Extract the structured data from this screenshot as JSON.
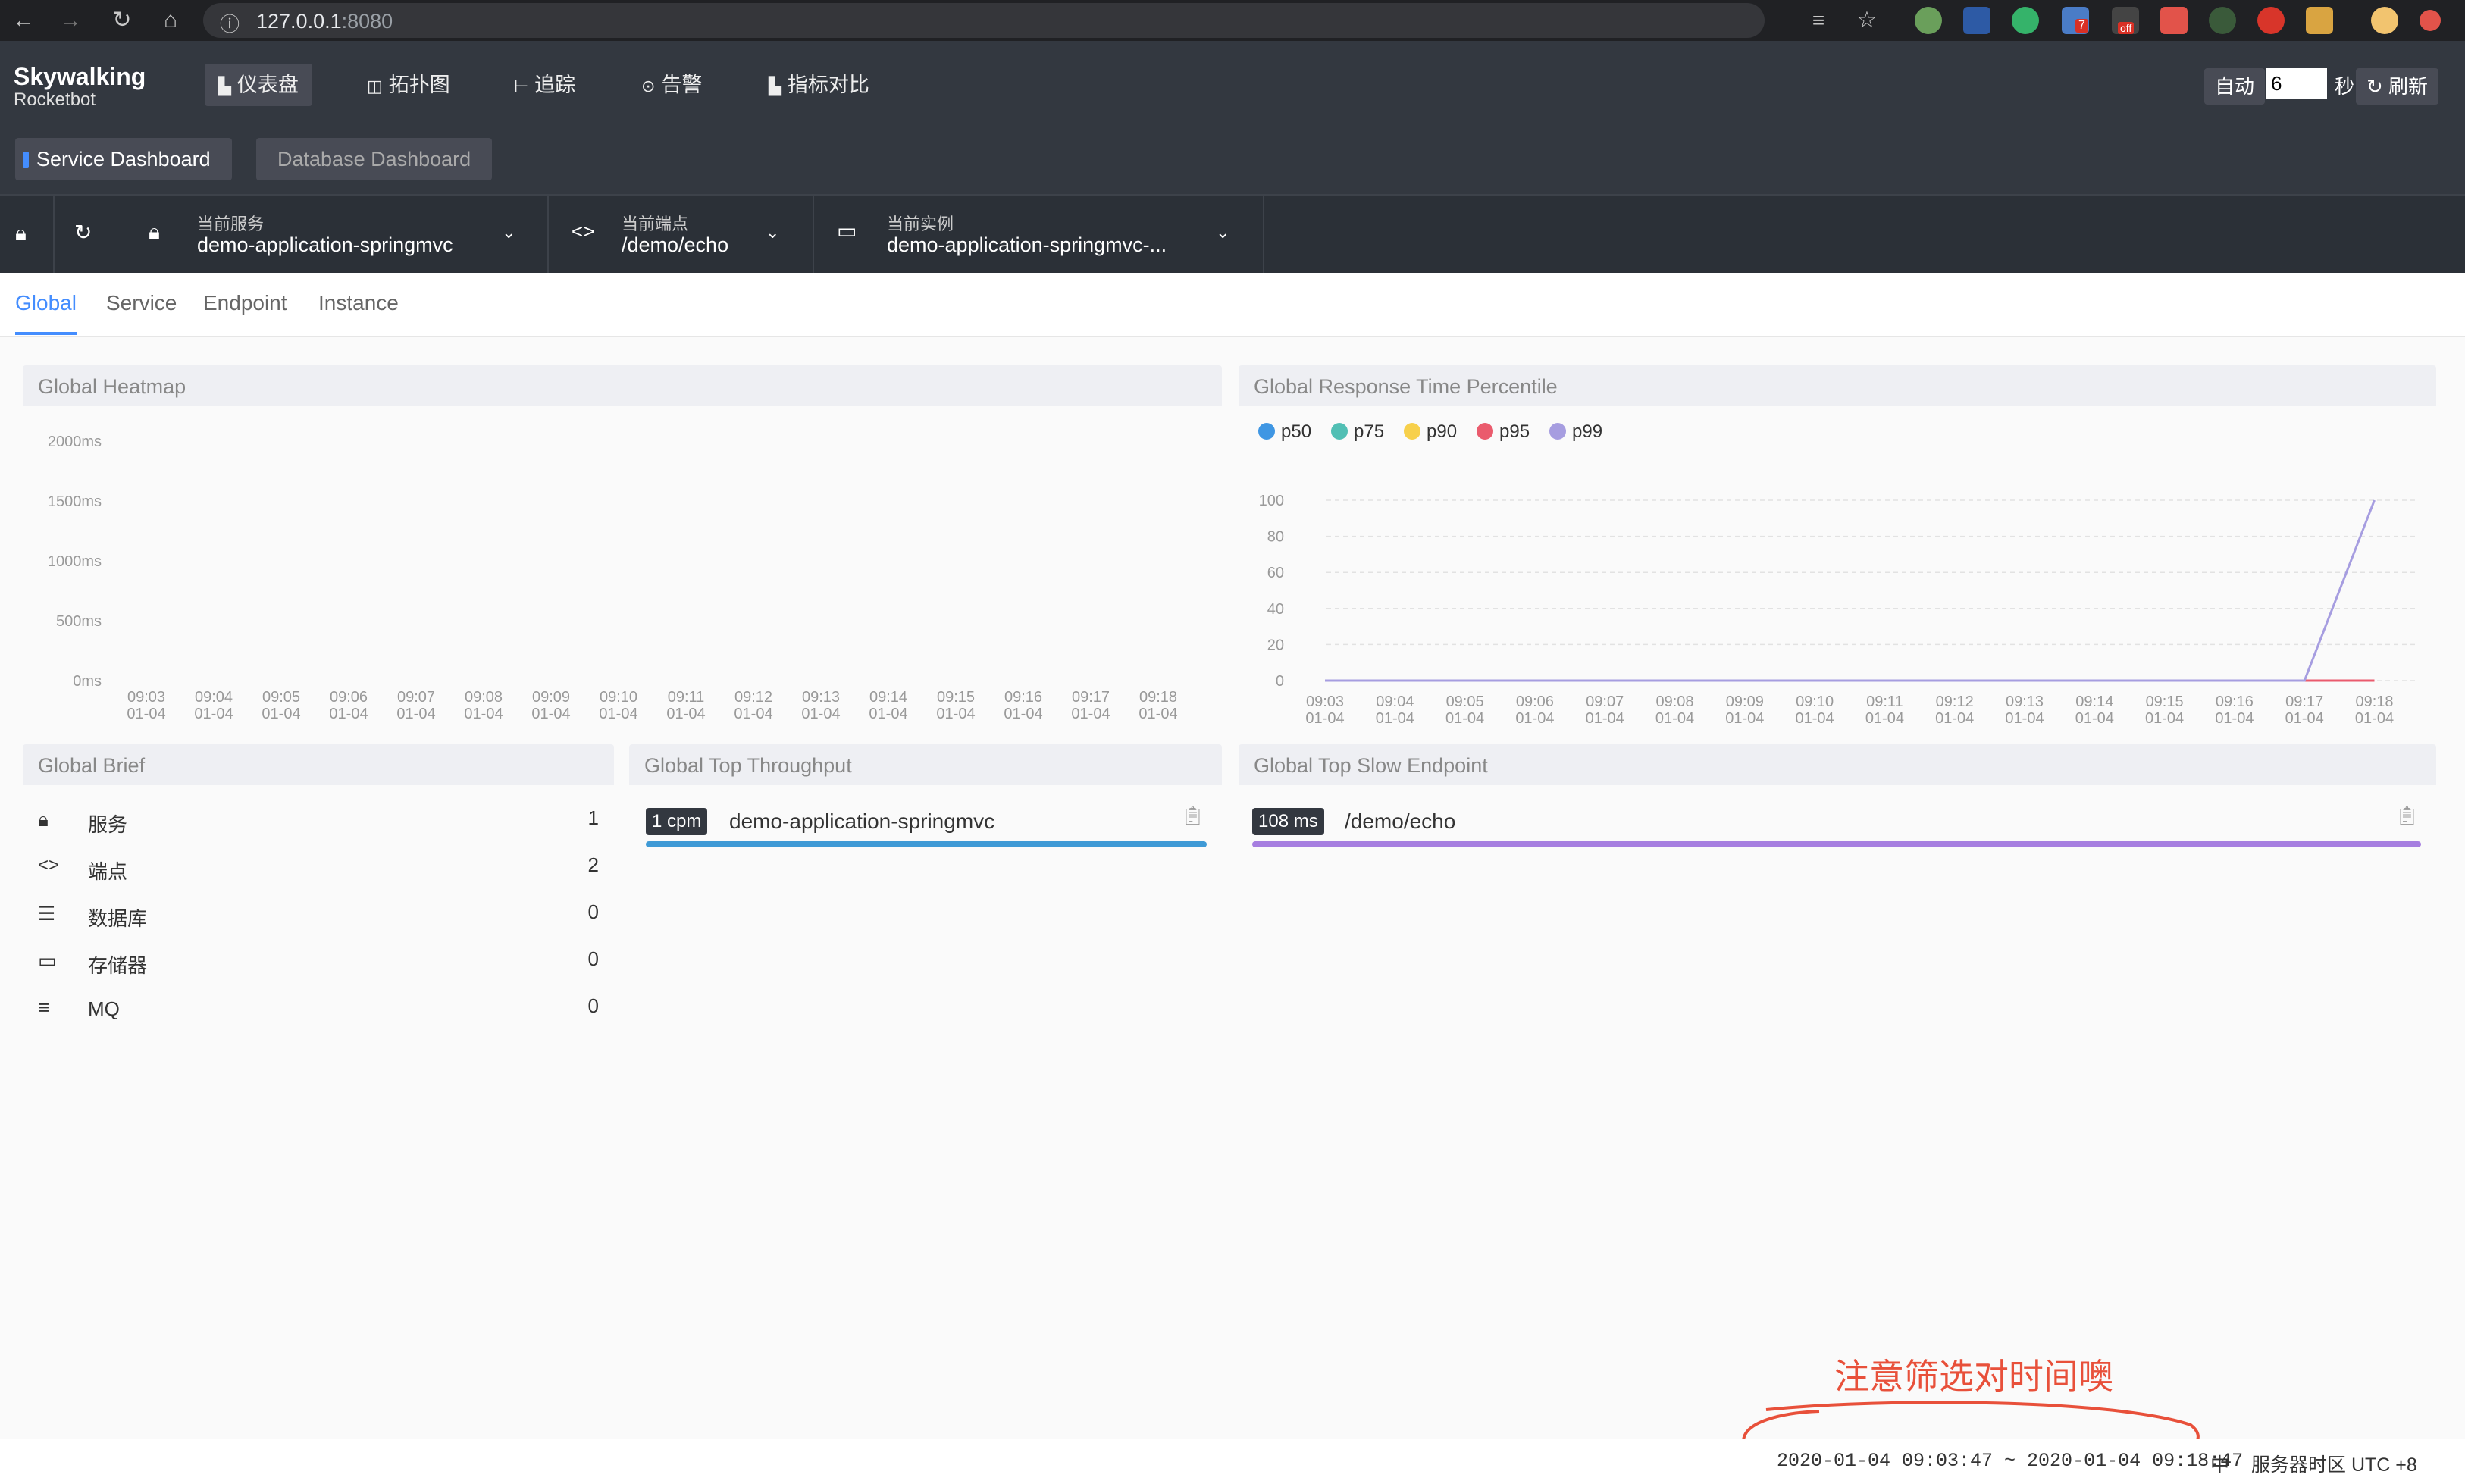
{
  "browser": {
    "url_host": "127.0.0.1",
    "url_port": ":8080",
    "ext_badges": [
      "7",
      "off"
    ]
  },
  "header": {
    "logo_line1": "Skywalking",
    "logo_line2": "Rocketbot",
    "nav": [
      {
        "label": "仪表盘",
        "icon": "chart-icon"
      },
      {
        "label": "拓扑图",
        "icon": "topology-icon"
      },
      {
        "label": "追踪",
        "icon": "trace-icon"
      },
      {
        "label": "告警",
        "icon": "alarm-icon"
      },
      {
        "label": "指标对比",
        "icon": "compare-icon"
      }
    ],
    "auto_label": "自动",
    "interval_value": "6",
    "seconds_label": "秒",
    "refresh_label": "刷新"
  },
  "dashboards": [
    "Service Dashboard",
    "Database Dashboard"
  ],
  "selectors": {
    "service_label": "当前服务",
    "service_value": "demo-application-springmvc",
    "endpoint_label": "当前端点",
    "endpoint_value": "/demo/echo",
    "instance_label": "当前实例",
    "instance_value": "demo-application-springmvc-..."
  },
  "tabs": [
    "Global",
    "Service",
    "Endpoint",
    "Instance"
  ],
  "heatmap": {
    "title": "Global Heatmap",
    "y_ticks": [
      "2000ms",
      "1500ms",
      "1000ms",
      "500ms",
      "0ms"
    ],
    "x_times": [
      "09:03",
      "09:04",
      "09:05",
      "09:06",
      "09:07",
      "09:08",
      "09:09",
      "09:10",
      "09:11",
      "09:12",
      "09:13",
      "09:14",
      "09:15",
      "09:16",
      "09:17",
      "09:18"
    ],
    "x_date": "01-04"
  },
  "percentile": {
    "title": "Global Response Time Percentile"
  },
  "brief": {
    "title": "Global Brief",
    "rows": [
      {
        "label": "服务",
        "value": "1",
        "icon": "lock-icon"
      },
      {
        "label": "端点",
        "value": "2",
        "icon": "code-icon"
      },
      {
        "label": "数据库",
        "value": "0",
        "icon": "database-icon"
      },
      {
        "label": "存储器",
        "value": "0",
        "icon": "storage-icon"
      },
      {
        "label": "MQ",
        "value": "0",
        "icon": "list-icon"
      }
    ]
  },
  "throughput": {
    "title": "Global Top Throughput",
    "badge": "1 cpm",
    "name": "demo-application-springmvc",
    "bar_fraction": 1.0
  },
  "slow_endpoint": {
    "title": "Global Top Slow Endpoint",
    "badge": "108 ms",
    "name": "/demo/echo",
    "bar_fraction": 1.0
  },
  "footer": {
    "time_range": "2020-01-04 09:03:47 ~ 2020-01-04 09:18:47",
    "lang": "中",
    "timezone": "服务器时区 UTC +8"
  },
  "annotation": "注意筛选对时间噢",
  "colors": {
    "p50": "#3f96e3",
    "p75": "#51bfb4",
    "p90": "#f7d04b",
    "p95": "#ea5b6d",
    "p99": "#a69de0",
    "accent": "#448dfe",
    "throughput_bar": "#3f9ad6",
    "slow_bar": "#a67ee0",
    "annotation": "#e8503a"
  },
  "chart_data": [
    {
      "type": "heatmap",
      "title": "Global Heatmap",
      "categories": [
        "01-04 09:03",
        "01-04 09:04",
        "01-04 09:05",
        "01-04 09:06",
        "01-04 09:07",
        "01-04 09:08",
        "01-04 09:09",
        "01-04 09:10",
        "01-04 09:11",
        "01-04 09:12",
        "01-04 09:13",
        "01-04 09:14",
        "01-04 09:15",
        "01-04 09:16",
        "01-04 09:17",
        "01-04 09:18"
      ],
      "y_ticks": [
        "0ms",
        "500ms",
        "1000ms",
        "1500ms",
        "2000ms"
      ],
      "values": []
    },
    {
      "type": "line",
      "title": "Global Response Time Percentile",
      "x": [
        "09:03",
        "09:04",
        "09:05",
        "09:06",
        "09:07",
        "09:08",
        "09:09",
        "09:10",
        "09:11",
        "09:12",
        "09:13",
        "09:14",
        "09:15",
        "09:16",
        "09:17",
        "09:18"
      ],
      "x_date": "01-04",
      "ylim": [
        0,
        100
      ],
      "y_ticks": [
        0,
        20,
        40,
        60,
        80,
        100
      ],
      "legend_position": "top-left",
      "series": [
        {
          "name": "p50",
          "values": [
            0,
            0,
            0,
            0,
            0,
            0,
            0,
            0,
            0,
            0,
            0,
            0,
            0,
            0,
            0,
            0
          ]
        },
        {
          "name": "p75",
          "values": [
            0,
            0,
            0,
            0,
            0,
            0,
            0,
            0,
            0,
            0,
            0,
            0,
            0,
            0,
            0,
            0
          ]
        },
        {
          "name": "p90",
          "values": [
            0,
            0,
            0,
            0,
            0,
            0,
            0,
            0,
            0,
            0,
            0,
            0,
            0,
            0,
            0,
            0
          ]
        },
        {
          "name": "p95",
          "values": [
            0,
            0,
            0,
            0,
            0,
            0,
            0,
            0,
            0,
            0,
            0,
            0,
            0,
            0,
            0,
            0
          ]
        },
        {
          "name": "p99",
          "values": [
            0,
            0,
            0,
            0,
            0,
            0,
            0,
            0,
            0,
            0,
            0,
            0,
            0,
            0,
            0,
            100
          ]
        }
      ]
    }
  ]
}
